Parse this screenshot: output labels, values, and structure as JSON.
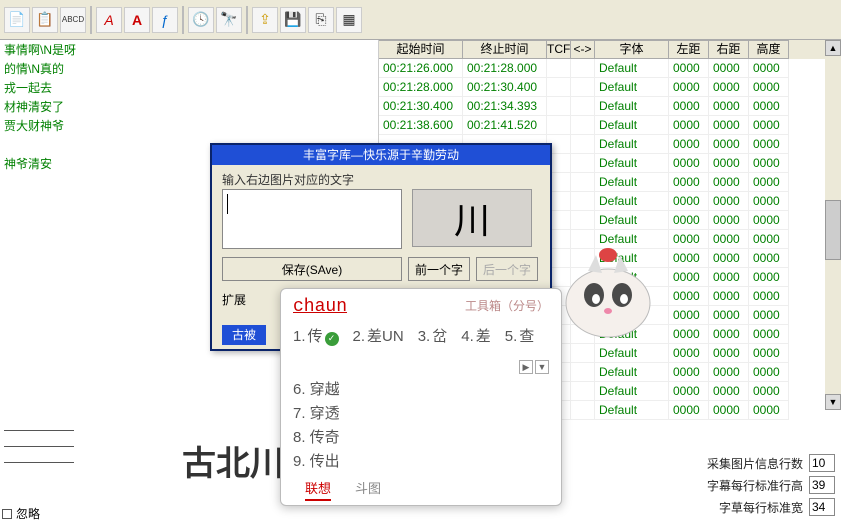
{
  "toolbar_icons": [
    "file",
    "doc",
    "abcd",
    "sep",
    "text-a",
    "bold-a",
    "fx",
    "sep",
    "clock",
    "binoc",
    "sep",
    "export",
    "save",
    "copy",
    "grid"
  ],
  "columns": {
    "start": "起始时间",
    "end": "终止时间",
    "tcp": "TCF",
    "arrow": "<->",
    "font": "字体",
    "left": "左距",
    "right": "右距",
    "height": "高度"
  },
  "left_items": [
    "事情啊\\N是呀",
    "的情\\N真的",
    "戎一起去",
    "材神清安了",
    "贾大财神爷",
    "",
    "神爷清安"
  ],
  "rows": [
    {
      "s": "00:21:26.000",
      "e": "00:21:28.000",
      "f": "Default",
      "l": "0000",
      "r": "0000",
      "h": "0000"
    },
    {
      "s": "00:21:28.000",
      "e": "00:21:30.400",
      "f": "Default",
      "l": "0000",
      "r": "0000",
      "h": "0000"
    },
    {
      "s": "00:21:30.400",
      "e": "00:21:34.393",
      "f": "Default",
      "l": "0000",
      "r": "0000",
      "h": "0000"
    },
    {
      "s": "00:21:38.600",
      "e": "00:21:41.520",
      "f": "Default",
      "l": "0000",
      "r": "0000",
      "h": "0000"
    },
    {
      "s": "",
      "e": "",
      "f": "Default",
      "l": "0000",
      "r": "0000",
      "h": "0000"
    },
    {
      "s": "",
      "e": "",
      "f": "Default",
      "l": "0000",
      "r": "0000",
      "h": "0000"
    },
    {
      "s": "",
      "e": "",
      "f": "Default",
      "l": "0000",
      "r": "0000",
      "h": "0000"
    },
    {
      "s": "",
      "e": "",
      "f": "Default",
      "l": "0000",
      "r": "0000",
      "h": "0000"
    },
    {
      "s": "",
      "e": "",
      "f": "Default",
      "l": "0000",
      "r": "0000",
      "h": "0000"
    },
    {
      "s": "",
      "e": "",
      "f": "Default",
      "l": "0000",
      "r": "0000",
      "h": "0000"
    },
    {
      "s": "",
      "e": "",
      "f": "Default",
      "l": "0000",
      "r": "0000",
      "h": "0000"
    },
    {
      "s": "",
      "e": "",
      "f": "Default",
      "l": "0000",
      "r": "0000",
      "h": "0000"
    },
    {
      "s": "",
      "e": "",
      "f": "Default",
      "l": "0000",
      "r": "0000",
      "h": "0000"
    },
    {
      "s": "",
      "e": "",
      "f": "Default",
      "l": "0000",
      "r": "0000",
      "h": "0000"
    },
    {
      "s": "",
      "e": "",
      "f": "Default",
      "l": "0000",
      "r": "0000",
      "h": "0000"
    },
    {
      "s": "",
      "e": "",
      "f": "Default",
      "l": "0000",
      "r": "0000",
      "h": "0000"
    },
    {
      "s": "",
      "e": "",
      "f": "Default",
      "l": "0000",
      "r": "0000",
      "h": "0000"
    },
    {
      "s": "",
      "e": "",
      "f": "Default",
      "l": "0000",
      "r": "0000",
      "h": "0000"
    },
    {
      "s": "",
      "e": "",
      "f": "Default",
      "l": "0000",
      "r": "0000",
      "h": "0000"
    }
  ],
  "dialog": {
    "title": "丰富字库—快乐源于辛勤劳动",
    "label": "输入右边图片对应的文字",
    "glyph": "川",
    "save": "保存(SAve)",
    "prev": "前一个字",
    "next": "后一个字",
    "ext": "扩展",
    "tag": "古被"
  },
  "ime": {
    "input": "chaun",
    "toolbox": "工具箱（分号）",
    "cands_row": [
      {
        "n": "1",
        "t": "传",
        "chk": true
      },
      {
        "n": "2",
        "t": "差UN"
      },
      {
        "n": "3",
        "t": "岔"
      },
      {
        "n": "4",
        "t": "差"
      },
      {
        "n": "5",
        "t": "查"
      }
    ],
    "cands_col": [
      {
        "n": "6",
        "t": "穿越"
      },
      {
        "n": "7",
        "t": "穿透"
      },
      {
        "n": "8",
        "t": "传奇"
      },
      {
        "n": "9",
        "t": "传出"
      }
    ],
    "tabs": {
      "active": "联想",
      "inactive": "斗图"
    }
  },
  "big_text": "古北川",
  "bottom": {
    "rows_label": "采集图片信息行数",
    "rows_val": "10",
    "height_label": "字幕每行标准行高",
    "height_val": "39",
    "width_label": "字草每行标准宽",
    "width_val": "34"
  },
  "tiny_label": "忽略"
}
